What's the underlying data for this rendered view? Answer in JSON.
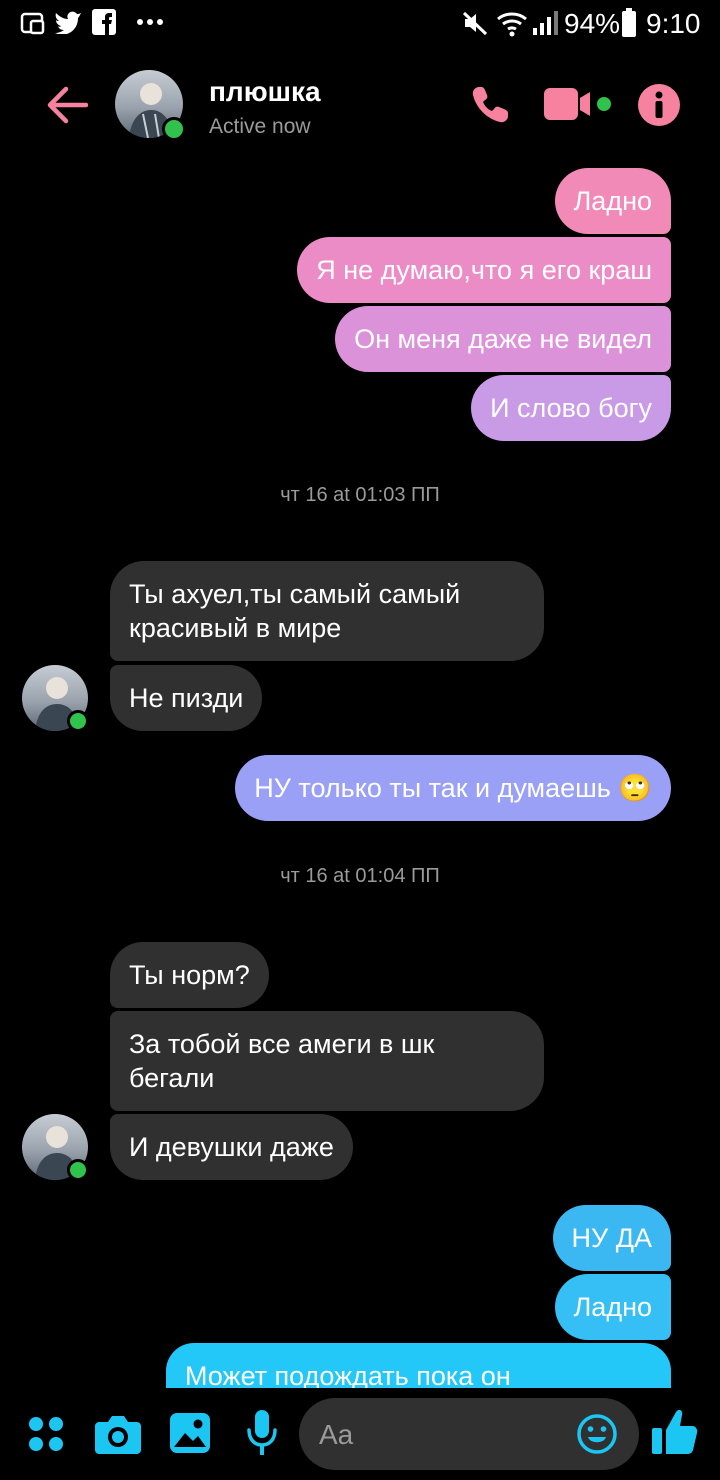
{
  "status_bar": {
    "battery": "94%",
    "time": "9:10",
    "left_icons": [
      "screenshot-icon",
      "twitter-icon",
      "facebook-icon",
      "more-dots-icon"
    ],
    "right_icons": [
      "mute-icon",
      "wifi-icon",
      "signal-icon",
      "battery-icon"
    ]
  },
  "header": {
    "contact_name": "плюшка",
    "status": "Active now",
    "icons": [
      "back-arrow-icon",
      "phone-icon",
      "video-camera-icon",
      "info-icon"
    ],
    "accent_color": "#f6829f"
  },
  "messages": [
    {
      "side": "out",
      "text": "Ладно"
    },
    {
      "side": "out",
      "text": "Я не думаю,что я его краш"
    },
    {
      "side": "out",
      "text": "Он меня даже не видел"
    },
    {
      "side": "out",
      "text": "И слово богу"
    },
    {
      "type": "timestamp",
      "text": "чт 16 at 01:03 ПП"
    },
    {
      "side": "in",
      "text": "Ты ахуел,ты самый самый\nкрасивый в мире"
    },
    {
      "side": "in",
      "text": "Не пизди"
    },
    {
      "side": "out",
      "text": "НУ только ты так и думаешь 🙄"
    },
    {
      "type": "timestamp",
      "text": "чт 16 at 01:04 ПП"
    },
    {
      "side": "in",
      "text": "Ты норм?"
    },
    {
      "side": "in",
      "text": "За тобой все амеги в шк\nбегали"
    },
    {
      "side": "in",
      "text": "И девушки даже"
    },
    {
      "side": "out",
      "text": "НУ ДА"
    },
    {
      "side": "out",
      "text": "Ладно"
    },
    {
      "side": "out",
      "text": "Может подождать пока он"
    }
  ],
  "bubble_colors": [
    "#f28ab8",
    "#ec8cc6",
    "#dc92d8",
    "#c99ae5",
    "#9aa0f5",
    "#3bb7f2",
    "#35bff4",
    "#23c8f8"
  ],
  "composer": {
    "placeholder": "Aa",
    "icons": [
      "menu-dots-icon",
      "camera-icon",
      "image-icon",
      "microphone-icon",
      "emoji-icon",
      "thumbs-up-icon"
    ],
    "accent_color": "#1cc6f2"
  }
}
